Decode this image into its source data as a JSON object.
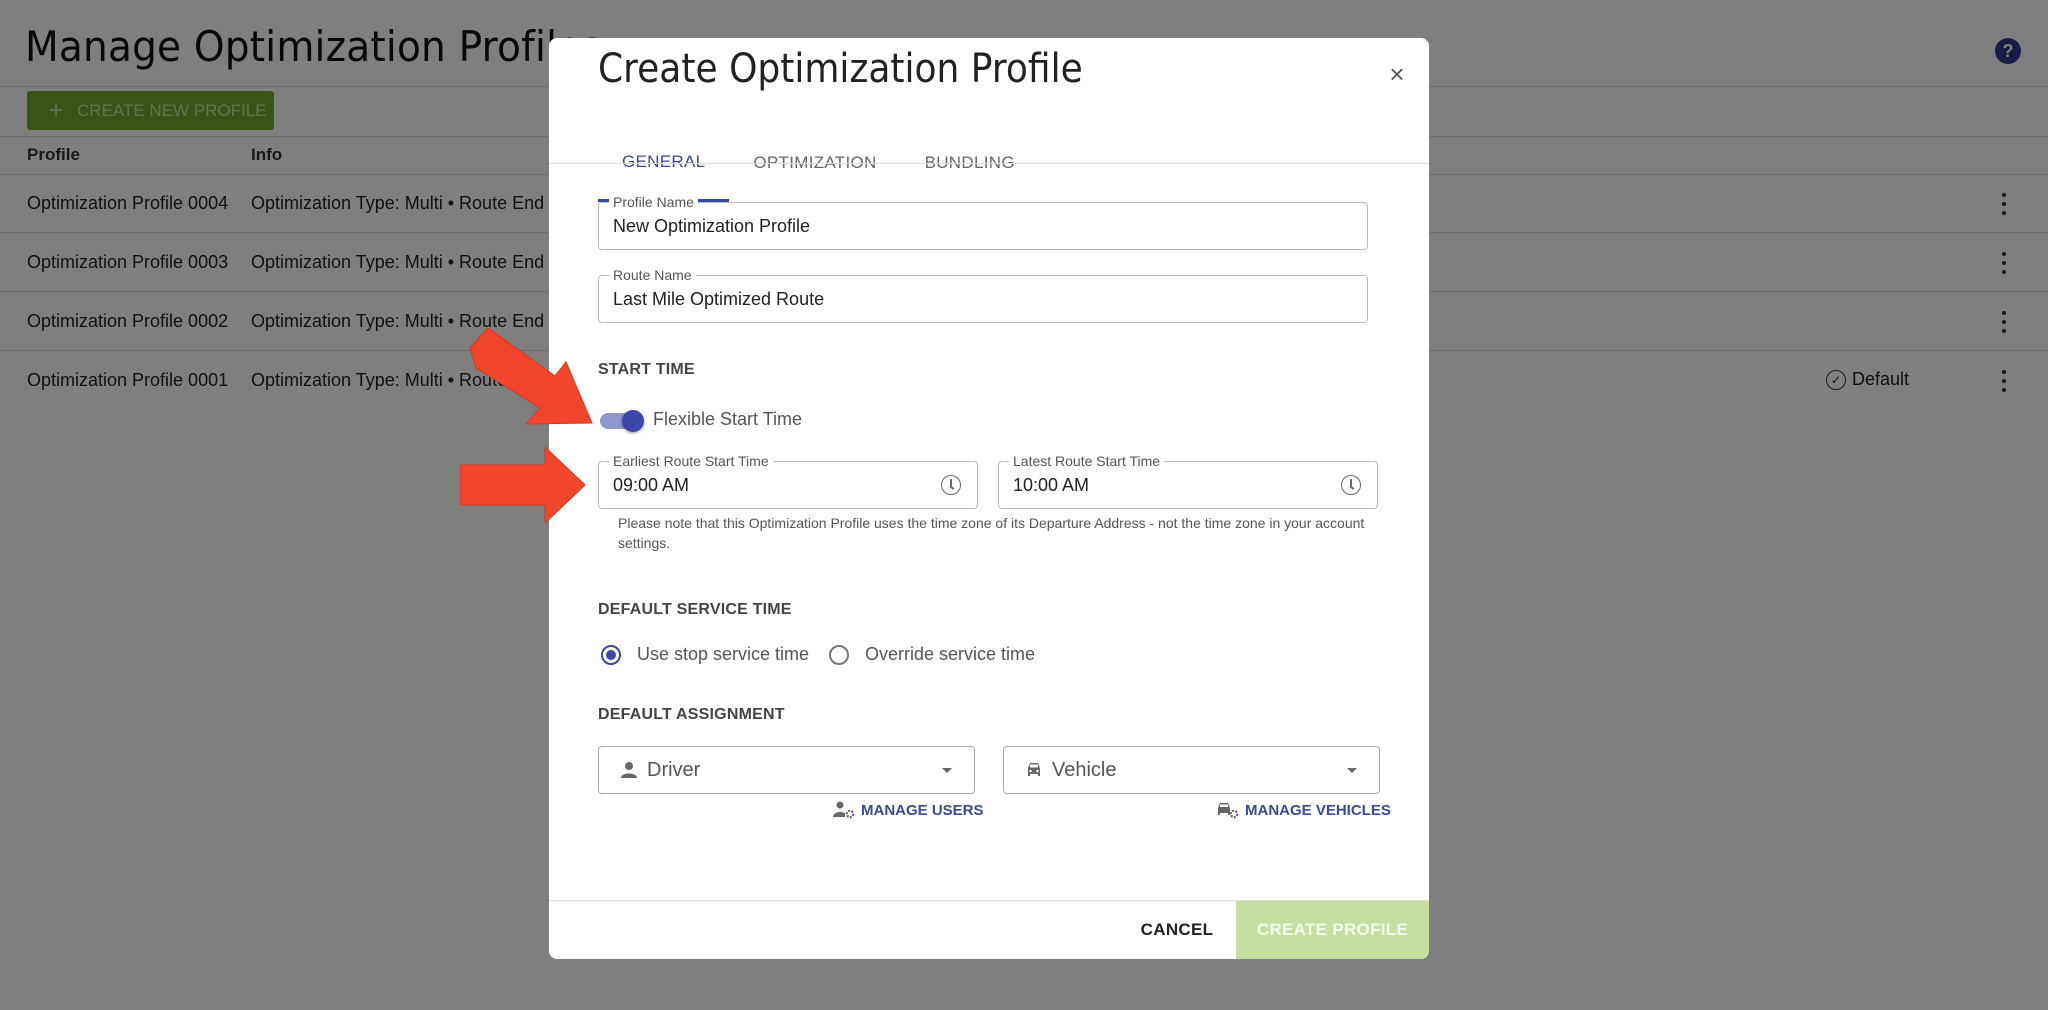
{
  "page": {
    "title": "Manage Optimization Profiles",
    "create_button": "CREATE NEW PROFILE",
    "help_icon": "?",
    "columns": {
      "profile": "Profile",
      "info": "Info"
    },
    "rows": [
      {
        "name": "Optimization Profile 0004",
        "info": "Optimization Type: Multi • Route End",
        "default": ""
      },
      {
        "name": "Optimization Profile 0003",
        "info": "Optimization Type: Multi • Route End",
        "default": ""
      },
      {
        "name": "Optimization Profile 0002",
        "info": "Optimization Type: Multi • Route End",
        "default": ""
      },
      {
        "name": "Optimization Profile 0001",
        "info": "Optimization Type: Multi • Route End",
        "default": "Default"
      }
    ]
  },
  "modal": {
    "title": "Create Optimization Profile",
    "close_icon": "×",
    "tabs": [
      {
        "label": "GENERAL",
        "active": true
      },
      {
        "label": "OPTIMIZATION",
        "active": false
      },
      {
        "label": "BUNDLING",
        "active": false
      }
    ],
    "profile_name": {
      "label": "Profile Name",
      "value": "New Optimization Profile"
    },
    "route_name": {
      "label": "Route Name",
      "value": "Last Mile Optimized Route"
    },
    "start_time": {
      "heading": "START TIME",
      "toggle_label": "Flexible Start Time",
      "toggle_on": true,
      "earliest": {
        "label": "Earliest Route Start Time",
        "value": "09:00 AM"
      },
      "latest": {
        "label": "Latest Route Start Time",
        "value": "10:00 AM"
      },
      "note": "Please note that this Optimization Profile uses the time zone of its Departure Address - not the time zone in your account settings."
    },
    "service_time": {
      "heading": "DEFAULT SERVICE TIME",
      "options": [
        {
          "label": "Use stop service time",
          "selected": true
        },
        {
          "label": "Override service time",
          "selected": false
        }
      ]
    },
    "assignment": {
      "heading": "DEFAULT ASSIGNMENT",
      "driver": {
        "placeholder": "Driver",
        "icon": "person-icon"
      },
      "vehicle": {
        "placeholder": "Vehicle",
        "icon": "car-icon"
      },
      "manage_users": "MANAGE USERS",
      "manage_vehicles": "MANAGE VEHICLES"
    },
    "footer": {
      "cancel": "CANCEL",
      "create": "CREATE PROFILE"
    }
  },
  "annotations": {
    "arrow_color": "#f2462c"
  },
  "colors": {
    "primary": "#3a46a8",
    "green": "#6fab2e",
    "green_disabled": "#c5dfa0"
  }
}
